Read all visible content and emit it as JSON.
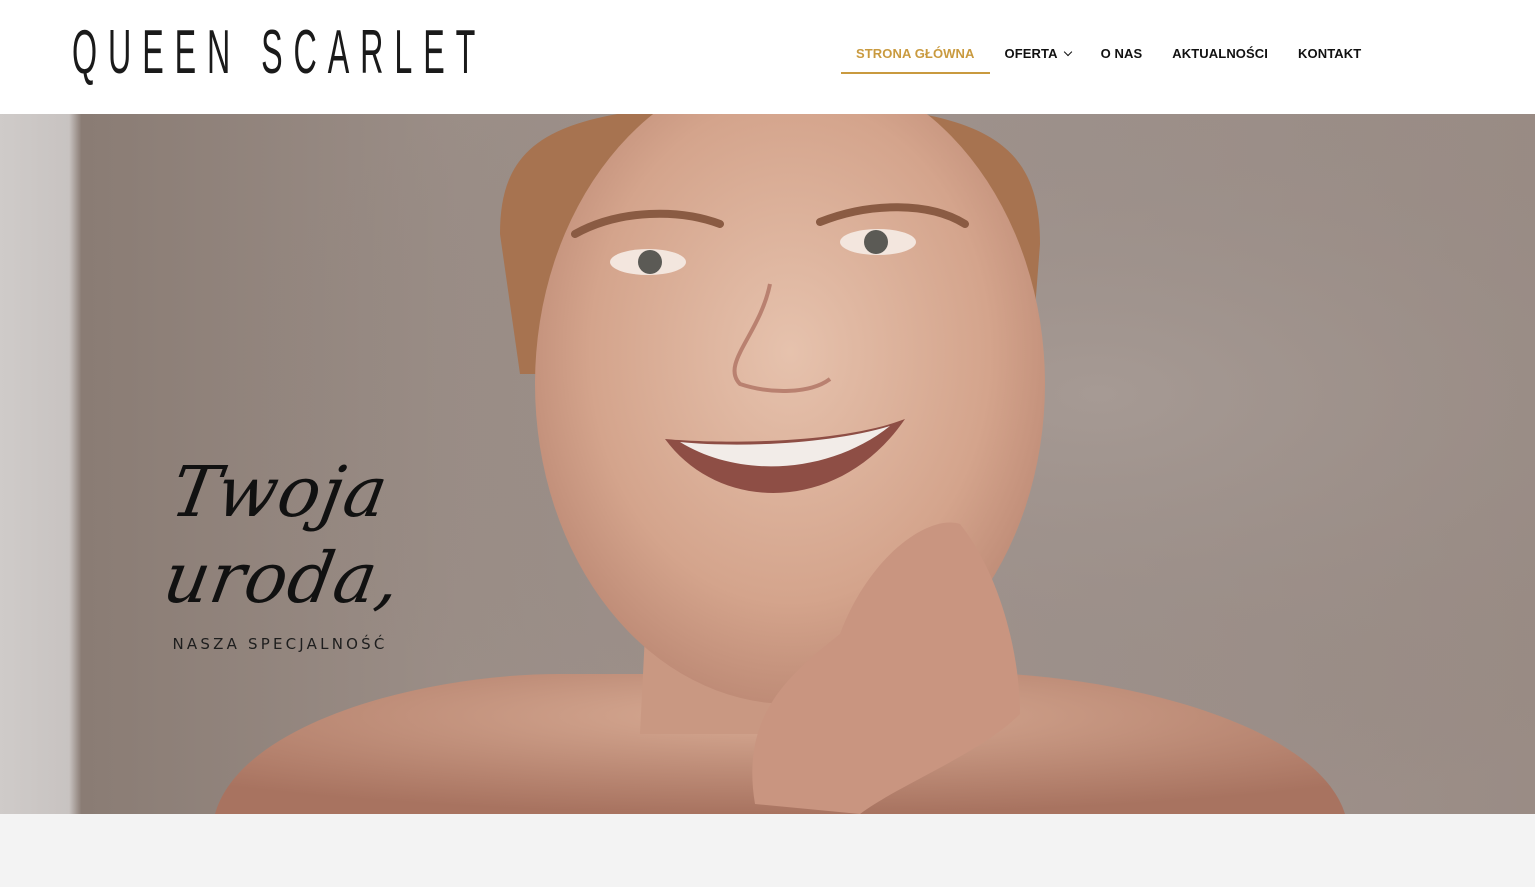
{
  "header": {
    "logo_text": "QUEEN SCARLET"
  },
  "nav": {
    "items": [
      {
        "label": "STRONA GŁÓWNA",
        "active": true
      },
      {
        "label": "OFERTA",
        "has_dropdown": true
      },
      {
        "label": "O NAS"
      },
      {
        "label": "AKTUALNOŚCI"
      },
      {
        "label": "KONTAKT"
      }
    ]
  },
  "hero": {
    "headline_line1": "Twoja",
    "headline_line2": "uroda,",
    "subtitle": "NASZA SPECJALNOŚĆ"
  },
  "colors": {
    "accent": "#c99a3f",
    "text": "#111111",
    "footer_band": "#f3f3f3"
  },
  "icons": {
    "dropdown": "chevron-down-icon"
  }
}
